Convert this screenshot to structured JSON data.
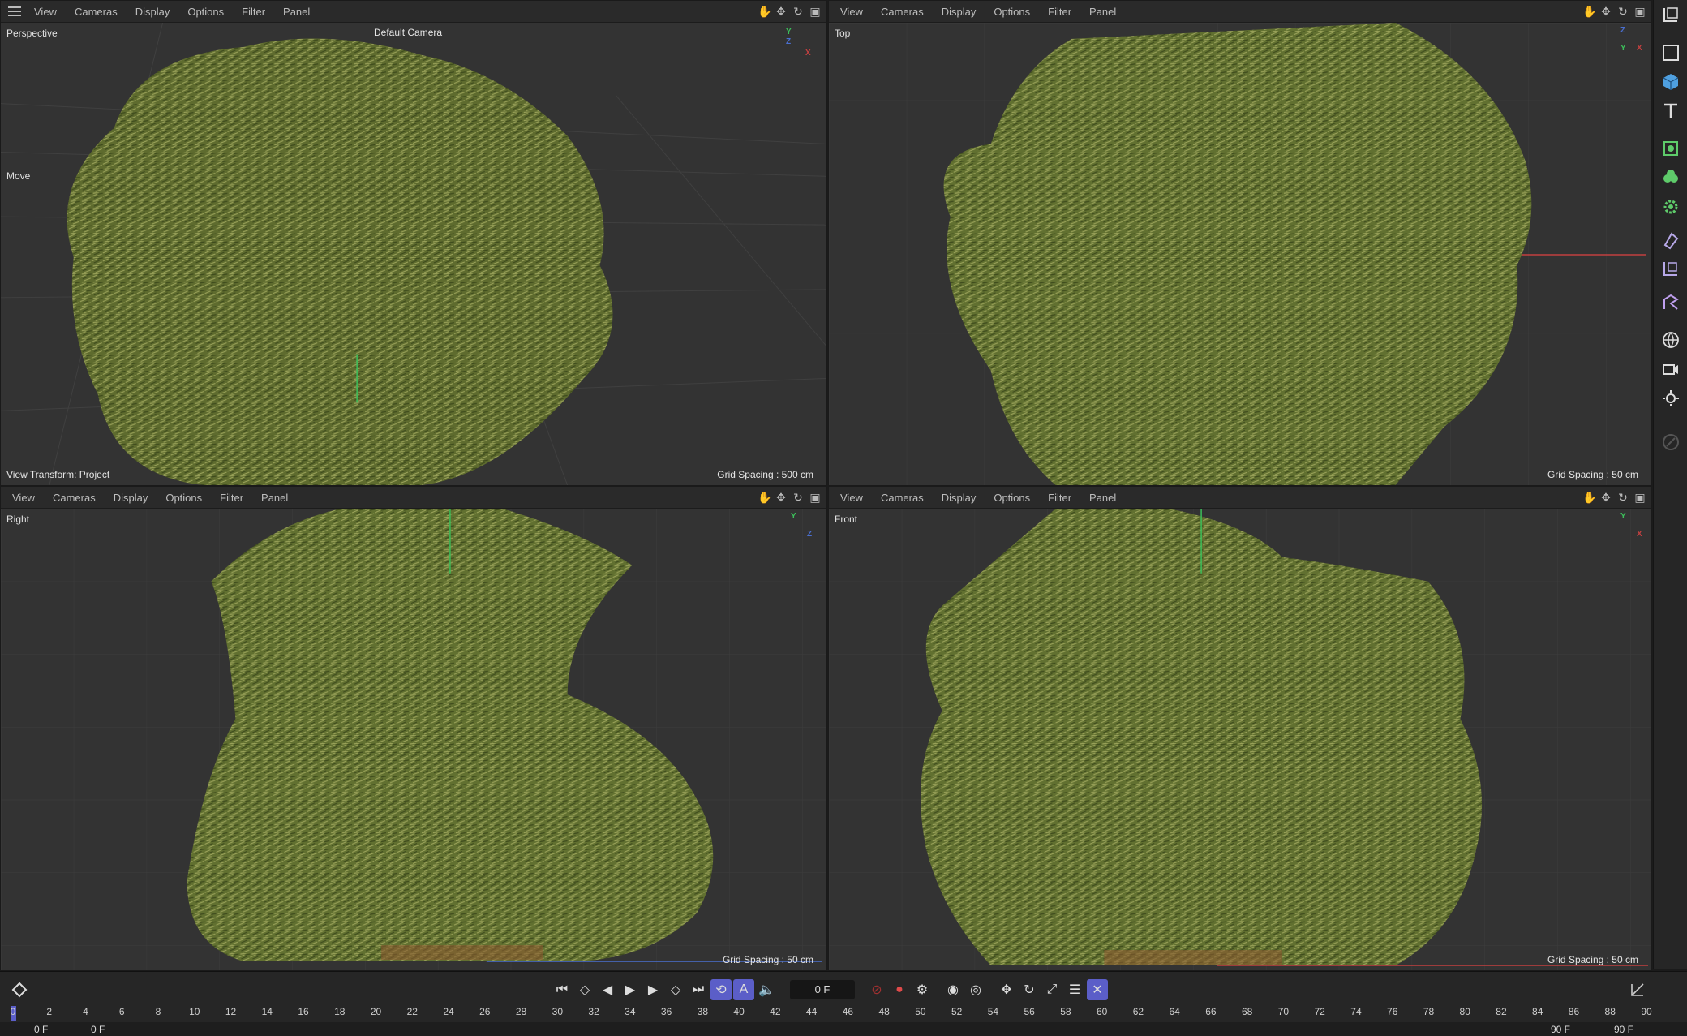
{
  "menus": [
    "View",
    "Cameras",
    "Display",
    "Options",
    "Filter",
    "Panel"
  ],
  "viewports": {
    "perspective": {
      "name": "Perspective",
      "camera": "Default Camera",
      "tool": "Move",
      "footer_left": "View Transform: Project",
      "grid": "Grid Spacing : 500 cm"
    },
    "top": {
      "name": "Top",
      "grid": "Grid Spacing : 50 cm"
    },
    "right": {
      "name": "Right",
      "grid": "Grid Spacing : 50 cm"
    },
    "front": {
      "name": "Front",
      "grid": "Grid Spacing : 50 cm"
    }
  },
  "axes": {
    "x": "X",
    "y": "Y",
    "z": "Z"
  },
  "colors": {
    "foliage": "#6f7d3a",
    "foliage_dark": "#3d4a1c",
    "foliage_light": "#9aa25a",
    "grid": "#3d3d3d",
    "bg": "#333333",
    "x_axis": "#c24040",
    "y_axis": "#3cbf5a",
    "z_axis": "#4a6fd0",
    "accent": "#5b5ec8"
  },
  "toolbar_icons": [
    "viewport-layout-icon",
    "rectangle-select-icon",
    "cube-icon",
    "text-icon",
    "generator-icon",
    "plant-icon",
    "gear-icon",
    "deformer-icon",
    "selection-icon",
    "spline-icon",
    "environment-icon",
    "camera-icon",
    "light-icon",
    "disabled-icon"
  ],
  "timeline": {
    "current_frame": "0 F",
    "start": "0 F",
    "min": "0 F",
    "end": "90 F",
    "max": "90 F",
    "ticks": [
      "0",
      "2",
      "4",
      "6",
      "8",
      "10",
      "12",
      "14",
      "16",
      "18",
      "20",
      "22",
      "24",
      "26",
      "28",
      "30",
      "32",
      "34",
      "36",
      "38",
      "40",
      "42",
      "44",
      "46",
      "48",
      "50",
      "52",
      "54",
      "56",
      "58",
      "60",
      "62",
      "64",
      "66",
      "68",
      "70",
      "72",
      "74",
      "76",
      "78",
      "80",
      "82",
      "84",
      "86",
      "88",
      "90"
    ]
  }
}
